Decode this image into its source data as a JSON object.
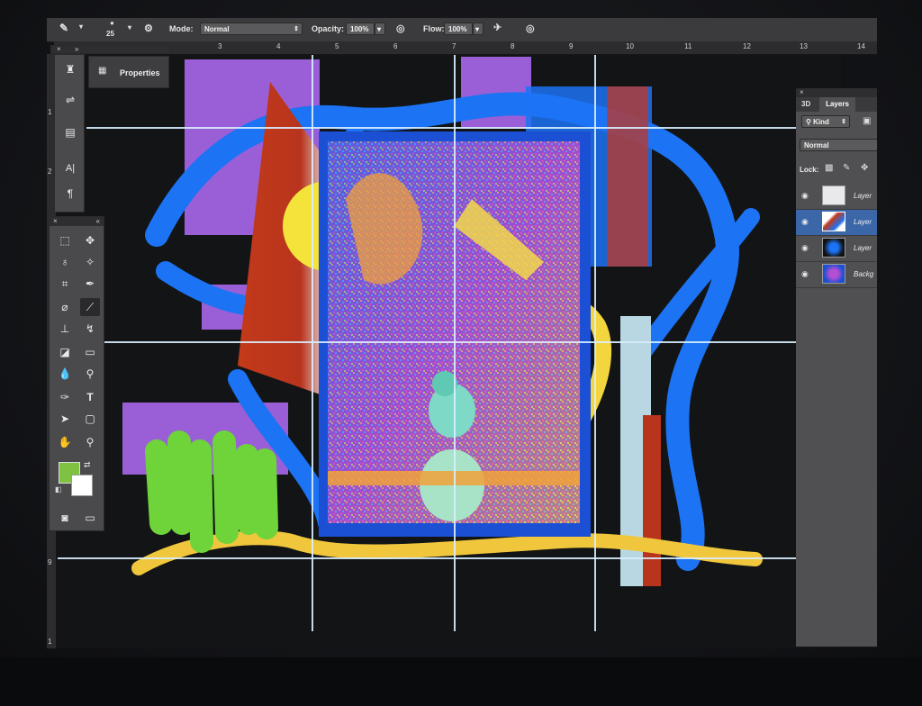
{
  "options_bar": {
    "brush_size": "25",
    "mode_label": "Mode:",
    "mode_value": "Normal",
    "opacity_label": "Opacity:",
    "opacity_value": "100%",
    "flow_label": "Flow:",
    "flow_value": "100%"
  },
  "ruler": {
    "top_ticks": [
      "3",
      "4",
      "5",
      "6",
      "7",
      "8",
      "9",
      "10",
      "11",
      "12",
      "13",
      "14"
    ],
    "left_ticks": [
      "1",
      "2",
      "9",
      "1"
    ]
  },
  "properties_panel": {
    "label": "Properties"
  },
  "layers_panel": {
    "tab_3d": "3D",
    "tab_layers": "Layers",
    "kind_label": "Kind",
    "blend_value": "Normal",
    "lock_label": "Lock:",
    "layers": [
      {
        "name": "Layer"
      },
      {
        "name": "Layer"
      },
      {
        "name": "Layer"
      },
      {
        "name": "Backg"
      }
    ]
  },
  "toolbar": {
    "text_tool": "T",
    "type_tool_label": "A|",
    "paragraph_label": "¶"
  },
  "colors": {
    "foreground": "#7fc242",
    "background": "#ffffff",
    "ui_dark": "#3b3b3d",
    "guide": "#d8eeff"
  },
  "icons": [
    "brush-icon",
    "stamp-icon",
    "airbrush-icon",
    "marquee-icon",
    "move-icon",
    "lasso-icon",
    "magic-wand-icon",
    "crop-icon",
    "eyedropper-icon",
    "healing-icon",
    "brush-tool-icon",
    "clone-stamp-icon",
    "history-brush-icon",
    "eraser-icon",
    "gradient-icon",
    "blur-icon",
    "dodge-icon",
    "pen-icon",
    "type-icon",
    "path-select-icon",
    "rectangle-icon",
    "hand-icon",
    "zoom-icon",
    "quick-mask-icon",
    "screen-mode-icon",
    "eye-icon",
    "lock-icon"
  ]
}
